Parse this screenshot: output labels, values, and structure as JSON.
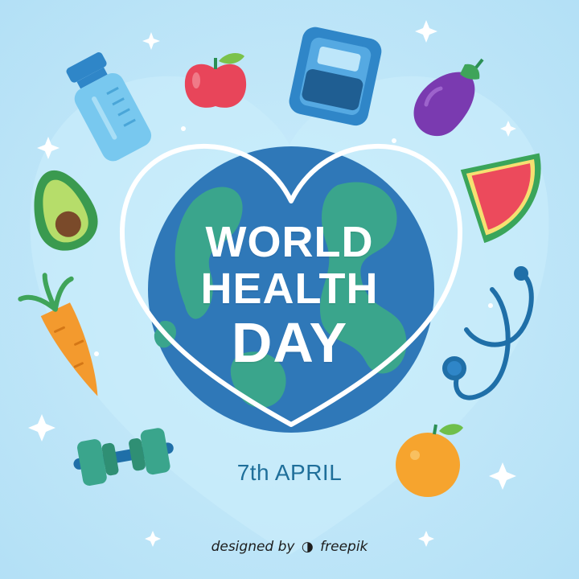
{
  "title": {
    "line1": "WORLD",
    "line2": "HEALTH",
    "line3": "DAY"
  },
  "date": "7th APRIL",
  "credit": {
    "text": "designed by",
    "brand": "freepik"
  },
  "colors": {
    "background": "#bfe6f8",
    "globe_ocean": "#2f78b8",
    "globe_land": "#3aa58c",
    "heart_outline": "#ffffff",
    "date_text": "#1f6f9a"
  },
  "icons": [
    "water-bottle-icon",
    "apple-icon",
    "scale-icon",
    "eggplant-icon",
    "avocado-icon",
    "watermelon-slice-icon",
    "carrot-icon",
    "stethoscope-icon",
    "dumbbell-icon",
    "orange-icon",
    "sparkle-icon"
  ]
}
